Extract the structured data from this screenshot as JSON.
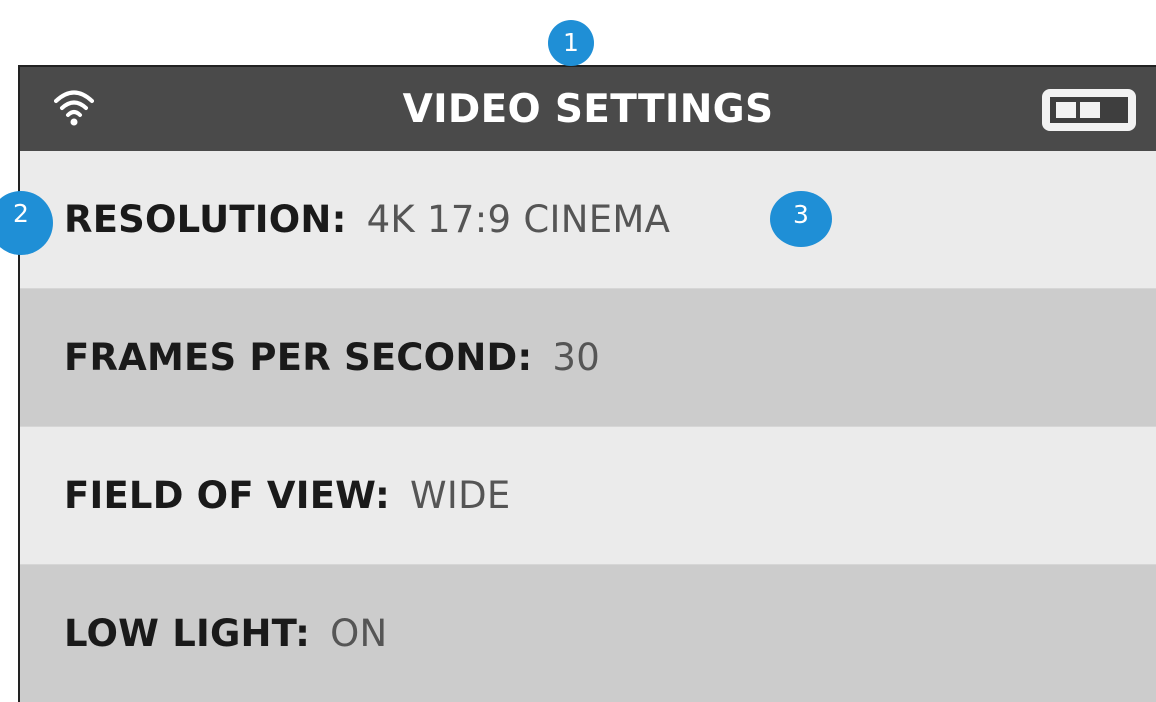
{
  "header": {
    "title": "VIDEO SETTINGS",
    "wifi_icon": "wifi-icon",
    "battery_icon": "battery-icon"
  },
  "settings": [
    {
      "label": "RESOLUTION:",
      "value": "4K 17:9 CINEMA"
    },
    {
      "label": "FRAMES PER SECOND:",
      "value": "30"
    },
    {
      "label": "FIELD OF VIEW:",
      "value": "WIDE"
    },
    {
      "label": "LOW LIGHT:",
      "value": "ON"
    }
  ],
  "callouts": [
    "1",
    "2",
    "3"
  ],
  "colors": {
    "header_bg": "#4a4a4a",
    "row_light": "#ebebeb",
    "row_dark": "#cccccc",
    "callout": "#1f8fd6"
  }
}
